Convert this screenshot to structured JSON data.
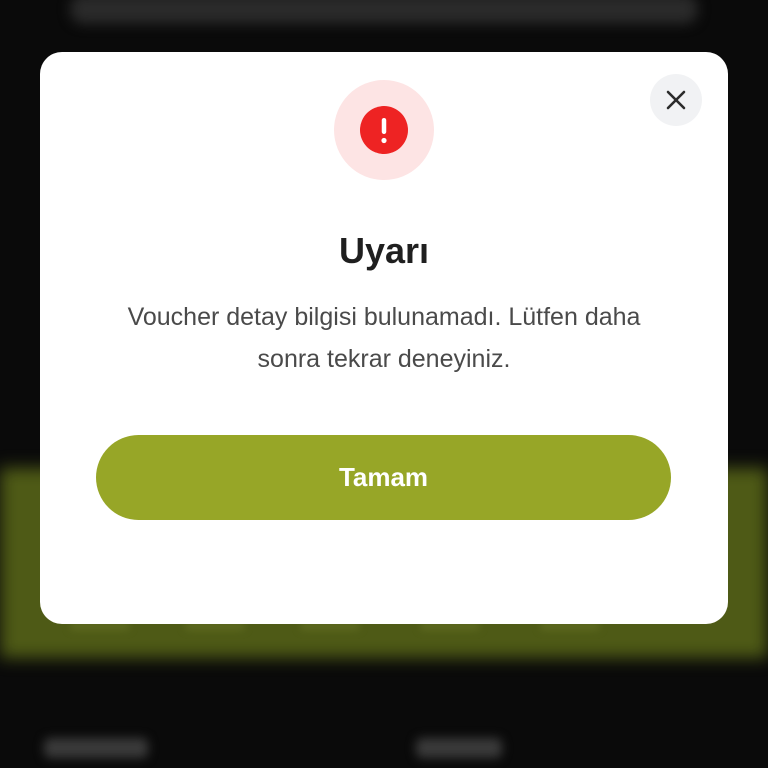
{
  "dialog": {
    "title": "Uyarı",
    "message": "Voucher detay bilgisi bulunamadı. Lütfen daha sonra tekrar deneyiniz.",
    "confirm_label": "Tamam",
    "close_icon": "close-icon",
    "alert_icon": "exclamation-icon"
  },
  "colors": {
    "accent": "#97a627",
    "alert": "#ee2323",
    "alert_halo": "#fde4e4",
    "overlay": "#0a0a0a"
  }
}
